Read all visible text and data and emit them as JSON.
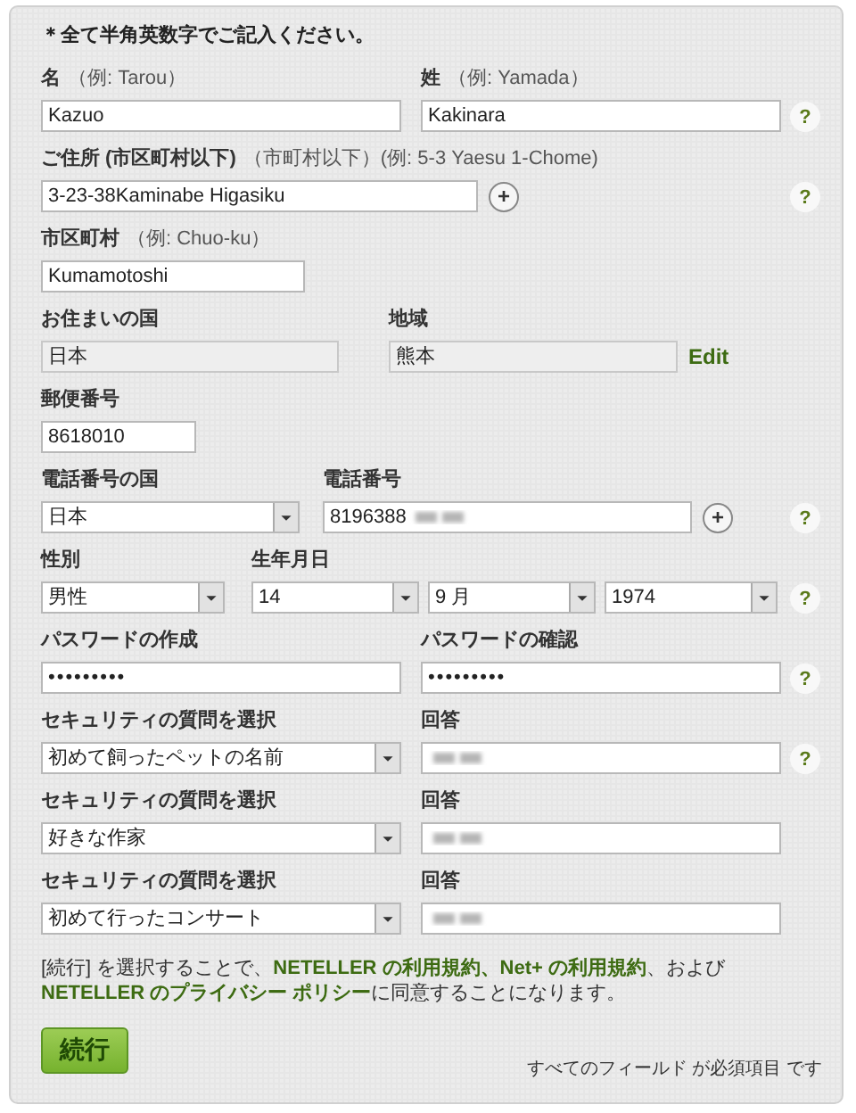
{
  "notice": "＊全て半角英数字でご記入ください。",
  "rows": [
    {
      "fields": [
        {
          "label": "名",
          "hint": "（例: Tarou）",
          "kind": "text",
          "value": "Kazuo"
        },
        {
          "label": "姓",
          "hint": "（例: Yamada）",
          "kind": "text",
          "value": "Kakinara"
        }
      ],
      "help": "?"
    },
    {
      "fields": [
        {
          "label": "ご住所 (市区町村以下)",
          "hint": "（市町村以下）(例: 5-3 Yaesu 1-Chome)",
          "kind": "text",
          "value": "3-23-38Kaminabe Higasiku"
        }
      ],
      "add": "+",
      "help": "?"
    },
    {
      "fields": [
        {
          "label": "市区町村",
          "hint": "（例: Chuo-ku）",
          "kind": "text",
          "value": "Kumamotoshi"
        }
      ]
    },
    {
      "fields": [
        {
          "label": "お住まいの国",
          "kind": "readonly",
          "value": "日本"
        },
        {
          "label": "地域",
          "kind": "readonly",
          "value": "熊本"
        }
      ],
      "edit": "Edit"
    },
    {
      "fields": [
        {
          "label": "郵便番号",
          "kind": "text",
          "value": "8618010"
        }
      ]
    },
    {
      "fields": [
        {
          "label": "電話番号の国",
          "kind": "select",
          "value": "日本"
        },
        {
          "label": "電話番号",
          "kind": "text",
          "value": "8196388",
          "blurred": true
        }
      ],
      "add": "+",
      "help": "?"
    },
    {
      "fields": [
        {
          "label": "性別",
          "kind": "select",
          "value": "男性"
        },
        {
          "label": "生年月日",
          "kind": "select",
          "value": "14"
        },
        {
          "kind": "select",
          "value": "9 月"
        },
        {
          "kind": "select",
          "value": "1974"
        }
      ],
      "help": "?"
    },
    {
      "fields": [
        {
          "label": "パスワードの作成",
          "kind": "password",
          "value": "•••••••••"
        },
        {
          "label": "パスワードの確認",
          "kind": "password",
          "value": "•••••••••"
        }
      ],
      "help": "?"
    },
    {
      "fields": [
        {
          "label": "セキュリティの質問を選択",
          "kind": "select",
          "value": "初めて飼ったペットの名前"
        },
        {
          "label": "回答",
          "kind": "text",
          "blurred": true
        }
      ],
      "help": "?"
    },
    {
      "fields": [
        {
          "label": "セキュリティの質問を選択",
          "kind": "select",
          "value": "好きな作家"
        },
        {
          "label": "回答",
          "kind": "text",
          "blurred": true
        }
      ]
    },
    {
      "fields": [
        {
          "label": "セキュリティの質問を選択",
          "kind": "select",
          "value": "初めて行ったコンサート"
        },
        {
          "label": "回答",
          "kind": "text",
          "blurred": true
        }
      ]
    }
  ],
  "terms": [
    {
      "kind": "plain",
      "text": "[続行] を選択することで、"
    },
    {
      "kind": "link",
      "text": "NETELLER の利用規約、"
    },
    {
      "kind": "link",
      "text": "Net+ の利用規約"
    },
    {
      "kind": "plain",
      "text": "、および "
    },
    {
      "kind": "link",
      "text": "NETELLER のプライバシー ポリシー"
    },
    {
      "kind": "plain",
      "text": "に同意することになります。"
    }
  ],
  "submit": "続行",
  "required_note": "すべてのフィールド が必須項目 です"
}
